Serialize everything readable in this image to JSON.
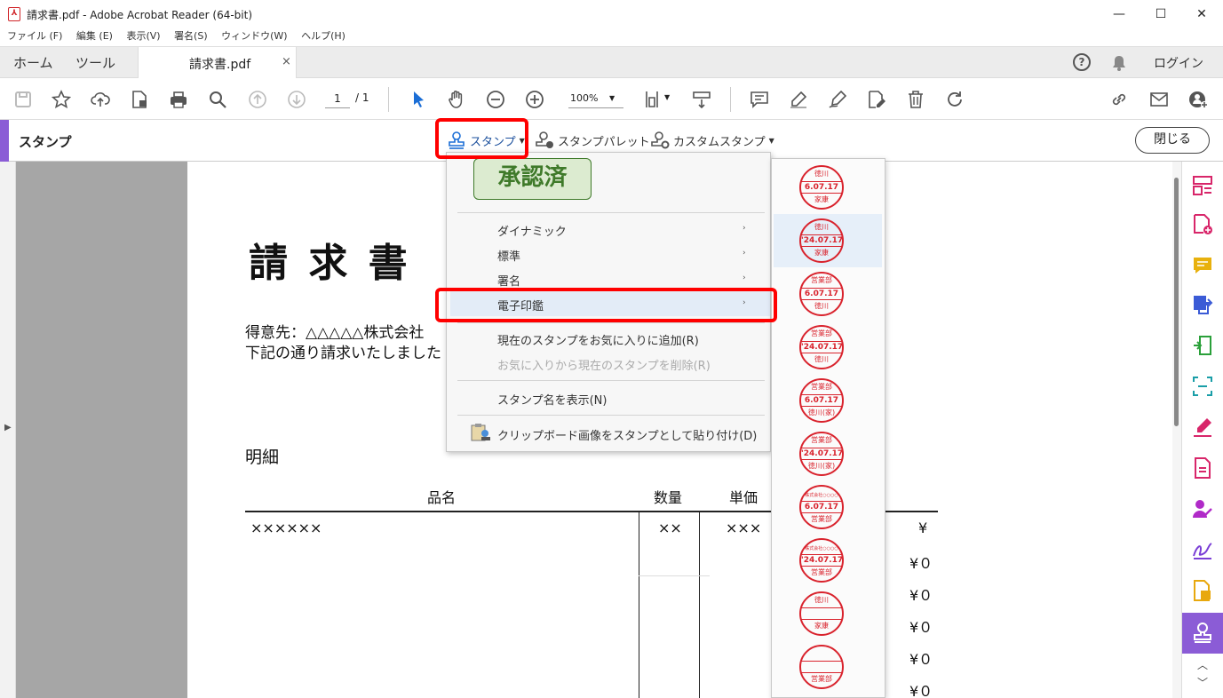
{
  "window": {
    "title": "請求書.pdf - Adobe Acrobat Reader (64-bit)",
    "min": "—",
    "max": "☐",
    "close": "✕"
  },
  "menubar": [
    "ファイル (F)",
    "編集 (E)",
    "表示(V)",
    "署名(S)",
    "ウィンドウ(W)",
    "ヘルプ(H)"
  ],
  "tabs": {
    "home": "ホーム",
    "tools": "ツール",
    "doc": "請求書.pdf",
    "close": "×",
    "help": "?",
    "login": "ログイン"
  },
  "toolbar": {
    "page_current": "1",
    "page_total": "/ 1",
    "zoom": "100%"
  },
  "stampbar": {
    "label": "スタンプ",
    "stamp_btn": "スタンプ",
    "palette_btn": "スタンプパレット",
    "custom_btn": "カスタムスタンプ",
    "close": "閉じる"
  },
  "stamp_menu": {
    "preview": "承認済",
    "items": [
      {
        "label": "ダイナミック",
        "arrow": "›"
      },
      {
        "label": "標準",
        "arrow": "›"
      },
      {
        "label": "署名",
        "arrow": "›"
      },
      {
        "label": "電子印鑑",
        "arrow": "›"
      },
      {
        "label": "現在のスタンプをお気に入りに追加(R)"
      },
      {
        "label": "お気に入りから現在のスタンプを削除(R)"
      },
      {
        "label": "スタンプ名を表示(N)"
      },
      {
        "label": "クリップボード画像をスタンプとして貼り付け(D)"
      }
    ]
  },
  "seals": [
    {
      "top": "徳川",
      "mid": "6.07.17",
      "bot": "家康"
    },
    {
      "top": "徳川",
      "mid": "'24.07.17",
      "bot": "家康"
    },
    {
      "top": "営業部",
      "mid": "6.07.17",
      "bot": "徳川"
    },
    {
      "top": "営業部",
      "mid": "'24.07.17",
      "bot": "徳川"
    },
    {
      "top": "営業部",
      "mid": "6.07.17",
      "bot": "徳川(家)"
    },
    {
      "top": "営業部",
      "mid": "'24.07.17",
      "bot": "徳川(家)"
    },
    {
      "top": "株式会社○○○○",
      "mid": "6.07.17",
      "bot": "営業部"
    },
    {
      "top": "株式会社○○○○",
      "mid": "'24.07.17",
      "bot": "営業部"
    },
    {
      "top": "徳川",
      "mid": "",
      "bot": "家康"
    },
    {
      "top": "",
      "mid": "",
      "bot": "営業部"
    }
  ],
  "document": {
    "title": "請 求 書",
    "line1": "得意先：△△△△△株式会社",
    "line2": "下記の通り請求いたしました",
    "section": "明細",
    "headers": {
      "name": "品名",
      "qty": "数量",
      "price": "単価"
    },
    "row1": {
      "name": "××××××",
      "qty": "××",
      "price": "×××",
      "amount": "¥"
    },
    "amounts": [
      "¥０",
      "¥０",
      "¥０",
      "¥０",
      "¥０"
    ]
  },
  "colors": {
    "accent": "#8b5cd6",
    "highlight": "#ff0000",
    "seal": "#d9232d",
    "approved_green": "#3f7a2a"
  }
}
